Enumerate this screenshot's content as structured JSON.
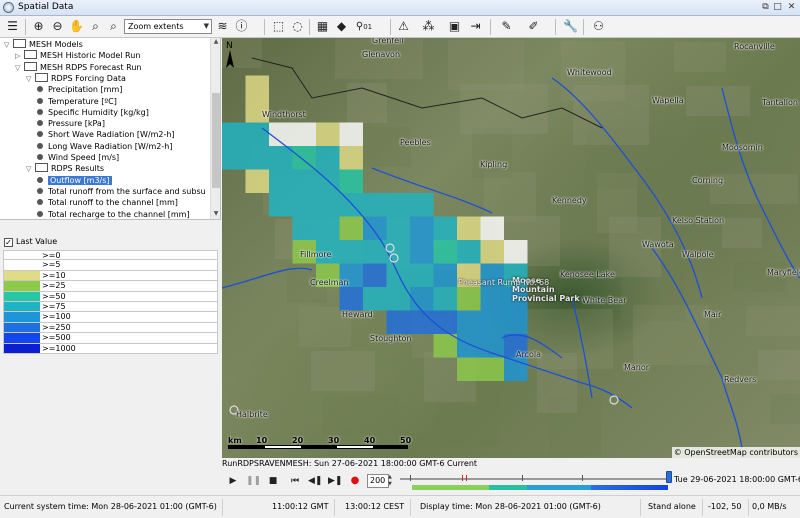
{
  "window": {
    "title": "Spatial Data"
  },
  "toolbar": {
    "zoom_value": "Zoom extents",
    "icons": [
      "menu-icon",
      "zoom-in-icon",
      "zoom-out-icon",
      "pan-icon",
      "zoom-box-icon",
      "zoom-back-icon",
      "layers-icon",
      "info-icon",
      "select-rectangle-icon",
      "lasso-icon",
      "grid-icon",
      "tag-icon",
      "pin-icon",
      "warning-icon",
      "node-tool-icon",
      "video-icon",
      "pencil-icon",
      "edit-icon",
      "wrench-icon",
      "lock-user-icon"
    ],
    "pin_badge": "01"
  },
  "tree": {
    "items": [
      {
        "label": "MESH Models",
        "level": 0,
        "expanded": true,
        "kind": "folder"
      },
      {
        "label": "MESH Historic Model Run",
        "level": 1,
        "expanded": false,
        "kind": "folder"
      },
      {
        "label": "MESH RDPS Forecast Run",
        "level": 1,
        "expanded": true,
        "kind": "folder"
      },
      {
        "label": "RDPS Forcing Data",
        "level": 2,
        "expanded": true,
        "kind": "folder"
      },
      {
        "label": "Precipitation [mm]",
        "level": 3,
        "kind": "leaf"
      },
      {
        "label": "Temperature [ºC]",
        "level": 3,
        "kind": "leaf"
      },
      {
        "label": "Specific Humidity [kg/kg]",
        "level": 3,
        "kind": "leaf"
      },
      {
        "label": "Pressure [kPa]",
        "level": 3,
        "kind": "leaf"
      },
      {
        "label": "Short Wave Radiation [W/m2-h]",
        "level": 3,
        "kind": "leaf"
      },
      {
        "label": "Long Wave Radiation [W/m2-h]",
        "level": 3,
        "kind": "leaf"
      },
      {
        "label": "Wind Speed [m/s]",
        "level": 3,
        "kind": "leaf"
      },
      {
        "label": "RDPS Results",
        "level": 2,
        "expanded": true,
        "kind": "folder"
      },
      {
        "label": "Outflow [m3/s]",
        "level": 3,
        "kind": "leaf",
        "selected": true
      },
      {
        "label": "Total runoff from the surface and subsu",
        "level": 3,
        "kind": "leaf"
      },
      {
        "label": "Total runoff to the channel [mm]",
        "level": 3,
        "kind": "leaf"
      },
      {
        "label": "Total recharge to the channel [mm]",
        "level": 3,
        "kind": "leaf"
      }
    ]
  },
  "legend": {
    "title": "Last Value",
    "checked": true,
    "rows": [
      {
        "label": ">=0",
        "color": "#ffffff"
      },
      {
        "label": ">=5",
        "color": "#ffffff"
      },
      {
        "label": ">=10",
        "color": "#e0dc86"
      },
      {
        "label": ">=25",
        "color": "#8ccb4a"
      },
      {
        "label": ">=50",
        "color": "#25c7a6"
      },
      {
        "label": ">=75",
        "color": "#1fb4c4"
      },
      {
        "label": ">=100",
        "color": "#1c96d8"
      },
      {
        "label": ">=250",
        "color": "#1e6fe0"
      },
      {
        "label": ">=500",
        "color": "#1446f0"
      },
      {
        "label": ">=1000",
        "color": "#0b1fd1"
      }
    ]
  },
  "map": {
    "places": [
      "Whitewood",
      "Rocanville",
      "Wapella",
      "Moosomin",
      "Peebles",
      "Kipling",
      "Kennedy",
      "Kelso Station",
      "Wawota",
      "Walpole",
      "Fillmore",
      "Heward",
      "Stoughton",
      "Moose Mountain Provincial Park",
      "Kenosee Lake",
      "White Bear",
      "Maryfield",
      "Mair",
      "Manor",
      "Redvers",
      "Halbrite",
      "Pheasant Rump No. 68",
      "Arcola",
      "Corning",
      "Glenavon",
      "Grenfell",
      "Creelman",
      "Windthorst",
      "Tantallon"
    ],
    "attribution": "© OpenStreetMap contributors",
    "scale": {
      "ticks": [
        "km",
        "10",
        "20",
        "30",
        "40",
        "50"
      ]
    },
    "grid_cells": [
      {
        "c": 1,
        "r": 1,
        "v": ">=10"
      },
      {
        "c": 1,
        "r": 2,
        "v": ">=10"
      },
      {
        "c": 0,
        "r": 3,
        "v": ">=75"
      },
      {
        "c": 1,
        "r": 3,
        "v": ">=75"
      },
      {
        "c": 2,
        "r": 3,
        "v": ">=5"
      },
      {
        "c": 3,
        "r": 3,
        "v": ">=0"
      },
      {
        "c": 4,
        "r": 3,
        "v": ">=10"
      },
      {
        "c": 5,
        "r": 3,
        "v": ">=5"
      },
      {
        "c": 0,
        "r": 4,
        "v": ">=75"
      },
      {
        "c": 1,
        "r": 4,
        "v": ">=75"
      },
      {
        "c": 2,
        "r": 4,
        "v": ">=75"
      },
      {
        "c": 3,
        "r": 4,
        "v": ">=50"
      },
      {
        "c": 4,
        "r": 4,
        "v": ">=75"
      },
      {
        "c": 5,
        "r": 4,
        "v": ">=10"
      },
      {
        "c": 1,
        "r": 5,
        "v": ">=10"
      },
      {
        "c": 2,
        "r": 5,
        "v": ">=75"
      },
      {
        "c": 3,
        "r": 5,
        "v": ">=75"
      },
      {
        "c": 4,
        "r": 5,
        "v": ">=75"
      },
      {
        "c": 5,
        "r": 5,
        "v": ">=50"
      },
      {
        "c": 2,
        "r": 6,
        "v": ">=75"
      },
      {
        "c": 3,
        "r": 6,
        "v": ">=75"
      },
      {
        "c": 4,
        "r": 6,
        "v": ">=75"
      },
      {
        "c": 5,
        "r": 6,
        "v": ">=75"
      },
      {
        "c": 6,
        "r": 6,
        "v": ">=75"
      },
      {
        "c": 7,
        "r": 6,
        "v": ">=75"
      },
      {
        "c": 8,
        "r": 6,
        "v": ">=75"
      },
      {
        "c": 3,
        "r": 7,
        "v": ">=75"
      },
      {
        "c": 4,
        "r": 7,
        "v": ">=75"
      },
      {
        "c": 5,
        "r": 7,
        "v": ">=25"
      },
      {
        "c": 6,
        "r": 7,
        "v": ">=100"
      },
      {
        "c": 7,
        "r": 7,
        "v": ">=75"
      },
      {
        "c": 8,
        "r": 7,
        "v": ">=100"
      },
      {
        "c": 9,
        "r": 7,
        "v": ">=75"
      },
      {
        "c": 10,
        "r": 7,
        "v": ">=10"
      },
      {
        "c": 11,
        "r": 7,
        "v": ">=5"
      },
      {
        "c": 3,
        "r": 8,
        "v": ">=25"
      },
      {
        "c": 4,
        "r": 8,
        "v": ">=75"
      },
      {
        "c": 5,
        "r": 8,
        "v": ">=75"
      },
      {
        "c": 6,
        "r": 8,
        "v": ">=75"
      },
      {
        "c": 7,
        "r": 8,
        "v": ">=75"
      },
      {
        "c": 8,
        "r": 8,
        "v": ">=100"
      },
      {
        "c": 9,
        "r": 8,
        "v": ">=50"
      },
      {
        "c": 10,
        "r": 8,
        "v": ">=75"
      },
      {
        "c": 11,
        "r": 8,
        "v": ">=10"
      },
      {
        "c": 12,
        "r": 8,
        "v": ">=5"
      },
      {
        "c": 4,
        "r": 9,
        "v": ">=25"
      },
      {
        "c": 5,
        "r": 9,
        "v": ">=100"
      },
      {
        "c": 6,
        "r": 9,
        "v": ">=250"
      },
      {
        "c": 7,
        "r": 9,
        "v": ">=75"
      },
      {
        "c": 8,
        "r": 9,
        "v": ">=75"
      },
      {
        "c": 9,
        "r": 9,
        "v": ">=100"
      },
      {
        "c": 10,
        "r": 9,
        "v": ">=10"
      },
      {
        "c": 11,
        "r": 9,
        "v": ">=100"
      },
      {
        "c": 12,
        "r": 9,
        "v": ">=75"
      },
      {
        "c": 5,
        "r": 10,
        "v": ">=250"
      },
      {
        "c": 6,
        "r": 10,
        "v": ">=75"
      },
      {
        "c": 7,
        "r": 10,
        "v": ">=75"
      },
      {
        "c": 8,
        "r": 10,
        "v": ">=100"
      },
      {
        "c": 9,
        "r": 10,
        "v": ">=75"
      },
      {
        "c": 10,
        "r": 10,
        "v": ">=25"
      },
      {
        "c": 11,
        "r": 10,
        "v": ">=100"
      },
      {
        "c": 12,
        "r": 10,
        "v": ">=100"
      },
      {
        "c": 7,
        "r": 11,
        "v": ">=250"
      },
      {
        "c": 8,
        "r": 11,
        "v": ">=250"
      },
      {
        "c": 9,
        "r": 11,
        "v": ">=250"
      },
      {
        "c": 10,
        "r": 11,
        "v": ">=100"
      },
      {
        "c": 11,
        "r": 11,
        "v": ">=100"
      },
      {
        "c": 12,
        "r": 11,
        "v": ">=100"
      },
      {
        "c": 9,
        "r": 12,
        "v": ">=25"
      },
      {
        "c": 10,
        "r": 12,
        "v": ">=100"
      },
      {
        "c": 11,
        "r": 12,
        "v": ">=100"
      },
      {
        "c": 12,
        "r": 12,
        "v": ">=250"
      },
      {
        "c": 10,
        "r": 13,
        "v": ">=25"
      },
      {
        "c": 11,
        "r": 13,
        "v": ">=25"
      },
      {
        "c": 12,
        "r": 13,
        "v": ">=100"
      }
    ]
  },
  "timeline": {
    "run_label": "RunRDPSRAVENMESH: Sun 27-06-2021 18:00:00 GMT-6 Current",
    "speed": "200",
    "end_date": "Tue 29-06-2021 18:00:00 GMT-6",
    "progress": 1.0,
    "controls": [
      "play-icon",
      "pause-icon",
      "stop-icon",
      "skip-start-icon",
      "step-back-icon",
      "step-forward-icon",
      "record-icon"
    ]
  },
  "status": {
    "system_time": "Current system time: Mon 28-06-2021 01:00 (GMT-6)",
    "gmt": "11:00:12 GMT",
    "cest": "13:00:12 CEST",
    "display_time": "Display time: Mon 28-06-2021 01:00 (GMT-6)",
    "mode": "Stand alone",
    "coords": "-102, 50",
    "rate": "0,0 MB/s"
  }
}
